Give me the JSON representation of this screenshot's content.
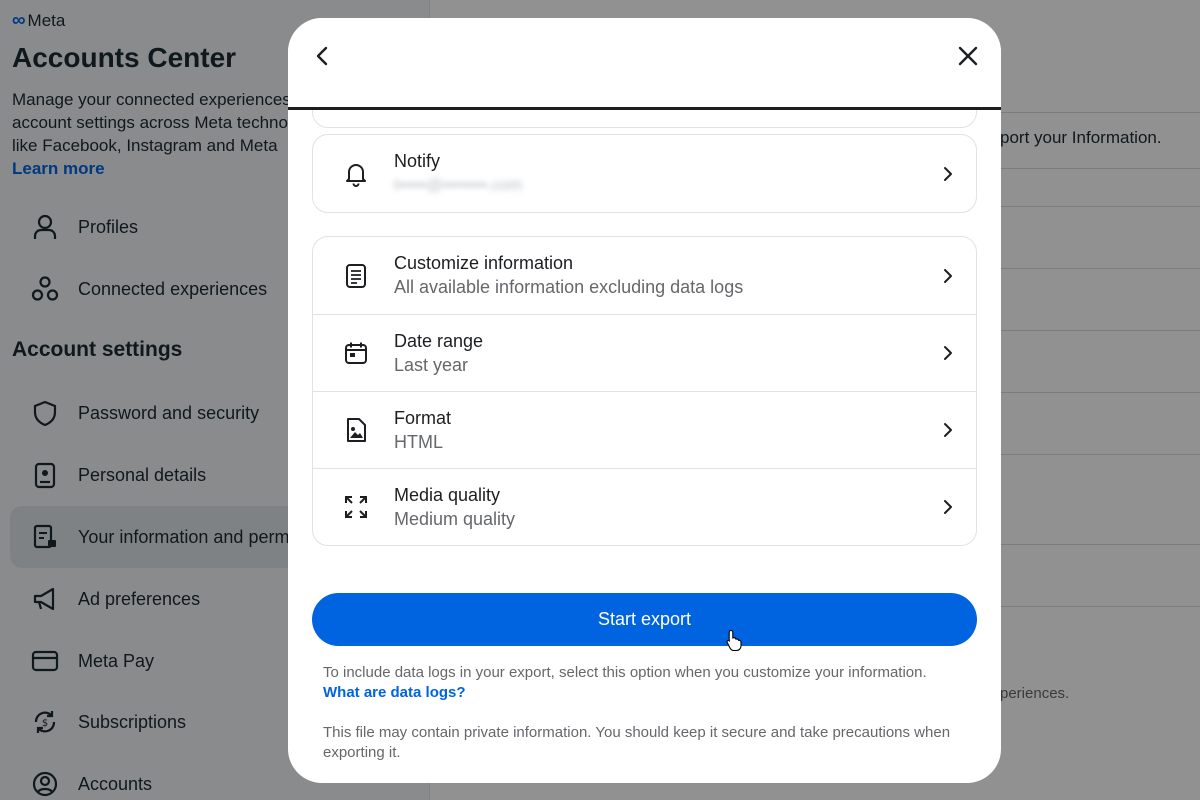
{
  "background": {
    "brand": "Meta",
    "title": "Accounts Center",
    "description_lines": [
      "Manage your connected experiences and",
      "account settings across Meta technologies",
      "like Facebook, Instagram and Meta"
    ],
    "learn_more": "Learn more",
    "nav_top": [
      {
        "label": "Profiles",
        "icon": "person-icon"
      },
      {
        "label": "Connected experiences",
        "icon": "connected-icon"
      }
    ],
    "section_heading": "Account settings",
    "nav_settings": [
      {
        "label": "Password and security",
        "icon": "shield-icon"
      },
      {
        "label": "Personal details",
        "icon": "id-badge-icon"
      },
      {
        "label": "Your information and permissions",
        "icon": "info-doc-icon"
      },
      {
        "label": "Ad preferences",
        "icon": "megaphone-icon"
      },
      {
        "label": "Meta Pay",
        "icon": "card-icon"
      },
      {
        "label": "Subscriptions",
        "icon": "subscription-icon"
      },
      {
        "label": "Accounts",
        "icon": "account-circle-icon"
      }
    ],
    "right_text_1": "port your Information.",
    "right_text_2": "periences."
  },
  "modal": {
    "notify": {
      "title": "Notify",
      "value": "t•••••@••••••••.com"
    },
    "options": [
      {
        "title": "Customize information",
        "value": "All available information excluding data logs",
        "icon": "document-list-icon"
      },
      {
        "title": "Date range",
        "value": "Last year",
        "icon": "calendar-icon"
      },
      {
        "title": "Format",
        "value": "HTML",
        "icon": "file-image-icon"
      },
      {
        "title": "Media quality",
        "value": "Medium quality",
        "icon": "expand-icon"
      }
    ],
    "start_export_label": "Start export",
    "note_1": "To include data logs in your export, select this option when you customize your information.",
    "note_1_link": "What are data logs?",
    "note_2": "This file may contain private information. You should keep it secure and take precautions when exporting it."
  },
  "colors": {
    "accent": "#0064e0",
    "overlay": "rgba(0,0,0,0.43)",
    "text": "#1c1e21",
    "muted": "#65676b"
  }
}
